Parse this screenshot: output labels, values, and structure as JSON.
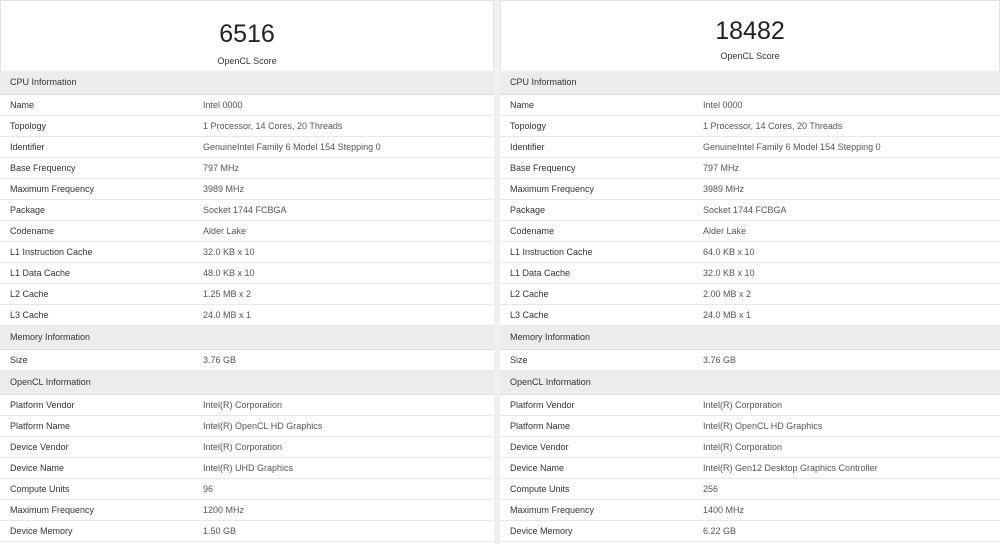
{
  "left": {
    "score": "6516",
    "score_label": "OpenCL Score",
    "cpu": {
      "header": "CPU Information",
      "rows": [
        {
          "k": "Name",
          "v": "Intel 0000"
        },
        {
          "k": "Topology",
          "v": "1 Processor, 14 Cores, 20 Threads"
        },
        {
          "k": "Identifier",
          "v": "GenuineIntel Family 6 Model 154 Stepping 0"
        },
        {
          "k": "Base Frequency",
          "v": "797 MHz"
        },
        {
          "k": "Maximum Frequency",
          "v": "3989 MHz"
        },
        {
          "k": "Package",
          "v": "Socket 1744 FCBGA"
        },
        {
          "k": "Codename",
          "v": "Alder Lake"
        },
        {
          "k": "L1 Instruction Cache",
          "v": "32.0 KB x 10"
        },
        {
          "k": "L1 Data Cache",
          "v": "48.0 KB x 10"
        },
        {
          "k": "L2 Cache",
          "v": "1.25 MB x 2"
        },
        {
          "k": "L3 Cache",
          "v": "24.0 MB x 1"
        }
      ]
    },
    "memory": {
      "header": "Memory Information",
      "rows": [
        {
          "k": "Size",
          "v": "3.76 GB"
        }
      ]
    },
    "opencl": {
      "header": "OpenCL Information",
      "rows": [
        {
          "k": "Platform Vendor",
          "v": "Intel(R) Corporation"
        },
        {
          "k": "Platform Name",
          "v": "Intel(R) OpenCL HD Graphics"
        },
        {
          "k": "Device Vendor",
          "v": "Intel(R) Corporation"
        },
        {
          "k": "Device Name",
          "v": "Intel(R) UHD Graphics"
        },
        {
          "k": "Compute Units",
          "v": "96"
        },
        {
          "k": "Maximum Frequency",
          "v": "1200 MHz"
        },
        {
          "k": "Device Memory",
          "v": "1.50 GB"
        }
      ]
    }
  },
  "right": {
    "score": "18482",
    "score_label": "OpenCL Score",
    "cpu": {
      "header": "CPU Information",
      "rows": [
        {
          "k": "Name",
          "v": "Intel 0000"
        },
        {
          "k": "Topology",
          "v": "1 Processor, 14 Cores, 20 Threads"
        },
        {
          "k": "Identifier",
          "v": "GenuineIntel Family 6 Model 154 Stepping 0"
        },
        {
          "k": "Base Frequency",
          "v": "797 MHz"
        },
        {
          "k": "Maximum Frequency",
          "v": "3989 MHz"
        },
        {
          "k": "Package",
          "v": "Socket 1744 FCBGA"
        },
        {
          "k": "Codename",
          "v": "Alder Lake"
        },
        {
          "k": "L1 Instruction Cache",
          "v": "64.0 KB x 10"
        },
        {
          "k": "L1 Data Cache",
          "v": "32.0 KB x 10"
        },
        {
          "k": "L2 Cache",
          "v": "2.00 MB x 2"
        },
        {
          "k": "L3 Cache",
          "v": "24.0 MB x 1"
        }
      ]
    },
    "memory": {
      "header": "Memory Information",
      "rows": [
        {
          "k": "Size",
          "v": "3.76 GB"
        }
      ]
    },
    "opencl": {
      "header": "OpenCL Information",
      "rows": [
        {
          "k": "Platform Vendor",
          "v": "Intel(R) Corporation"
        },
        {
          "k": "Platform Name",
          "v": "Intel(R) OpenCL HD Graphics"
        },
        {
          "k": "Device Vendor",
          "v": "Intel(R) Corporation"
        },
        {
          "k": "Device Name",
          "v": "Intel(R) Gen12 Desktop Graphics Controller"
        },
        {
          "k": "Compute Units",
          "v": "256"
        },
        {
          "k": "Maximum Frequency",
          "v": "1400 MHz"
        },
        {
          "k": "Device Memory",
          "v": "6.22 GB"
        }
      ]
    }
  }
}
